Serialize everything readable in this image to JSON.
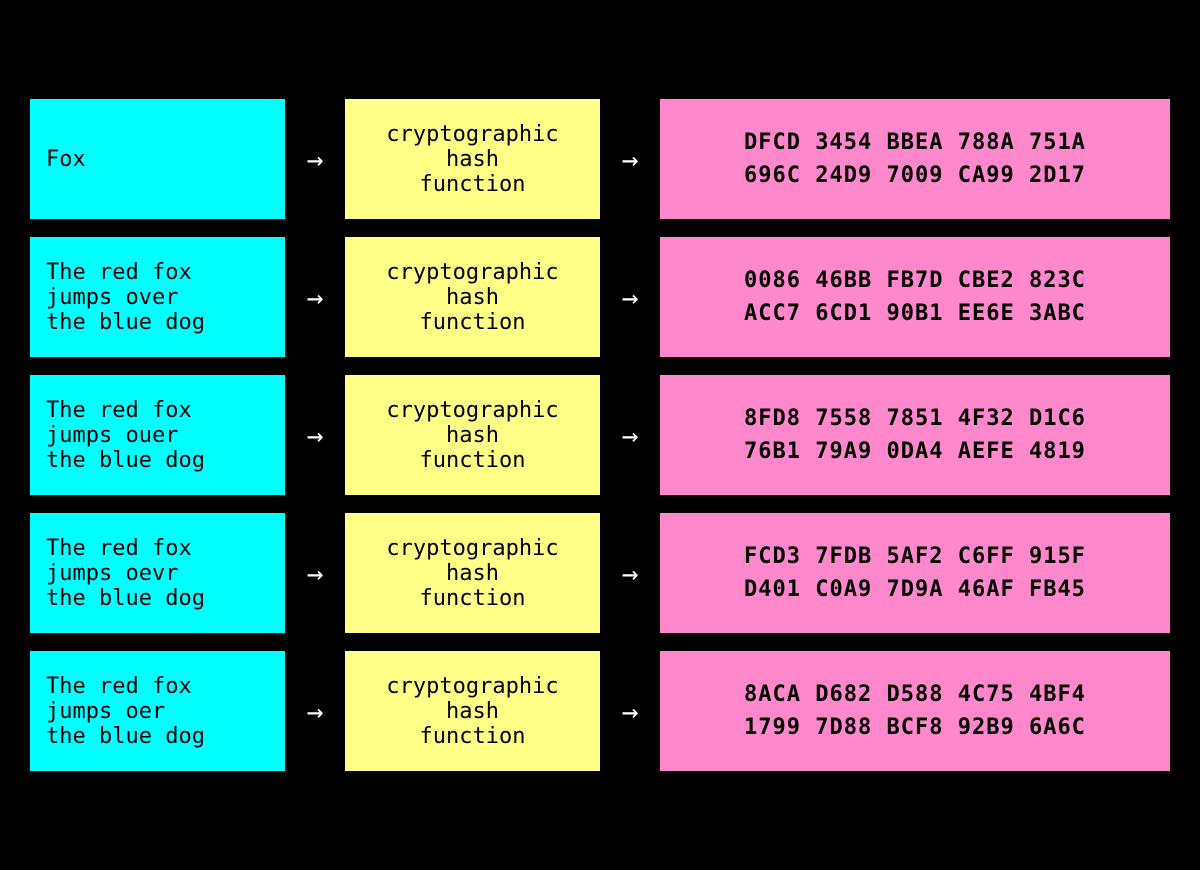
{
  "rows": [
    {
      "id": "row-fox",
      "input": "Fox",
      "hash_label": "cryptographic\nhash\nfunction",
      "output_line1": "DFCD  3454  BBEA  788A  751A",
      "output_line2": "696C  24D9  7009  CA99  2D17"
    },
    {
      "id": "row-full",
      "input": "The red fox\njumps over\nthe blue dog",
      "hash_label": "cryptographic\nhash\nfunction",
      "output_line1": "0086  46BB  FB7D  CBE2  823C",
      "output_line2": "ACC7  6CD1  90B1  EE6E  3ABC"
    },
    {
      "id": "row-ouer",
      "input": "The red fox\njumps ouer\nthe blue dog",
      "hash_label": "cryptographic\nhash\nfunction",
      "output_line1": "8FD8  7558  7851  4F32  D1C6",
      "output_line2": "76B1  79A9  0DA4  AEFE  4819"
    },
    {
      "id": "row-oevr",
      "input": "The red fox\njumps oevr\nthe blue dog",
      "hash_label": "cryptographic\nhash\nfunction",
      "output_line1": "FCD3  7FDB  5AF2  C6FF  915F",
      "output_line2": "D401  C0A9  7D9A  46AF  FB45"
    },
    {
      "id": "row-oer",
      "input": "The red fox\njumps oer\nthe blue dog",
      "hash_label": "cryptographic\nhash\nfunction",
      "output_line1": "8ACA  D682  D588  4C75  4BF4",
      "output_line2": "1799  7D88  BCF8  92B9  6A6C"
    }
  ],
  "arrow_char": "→"
}
